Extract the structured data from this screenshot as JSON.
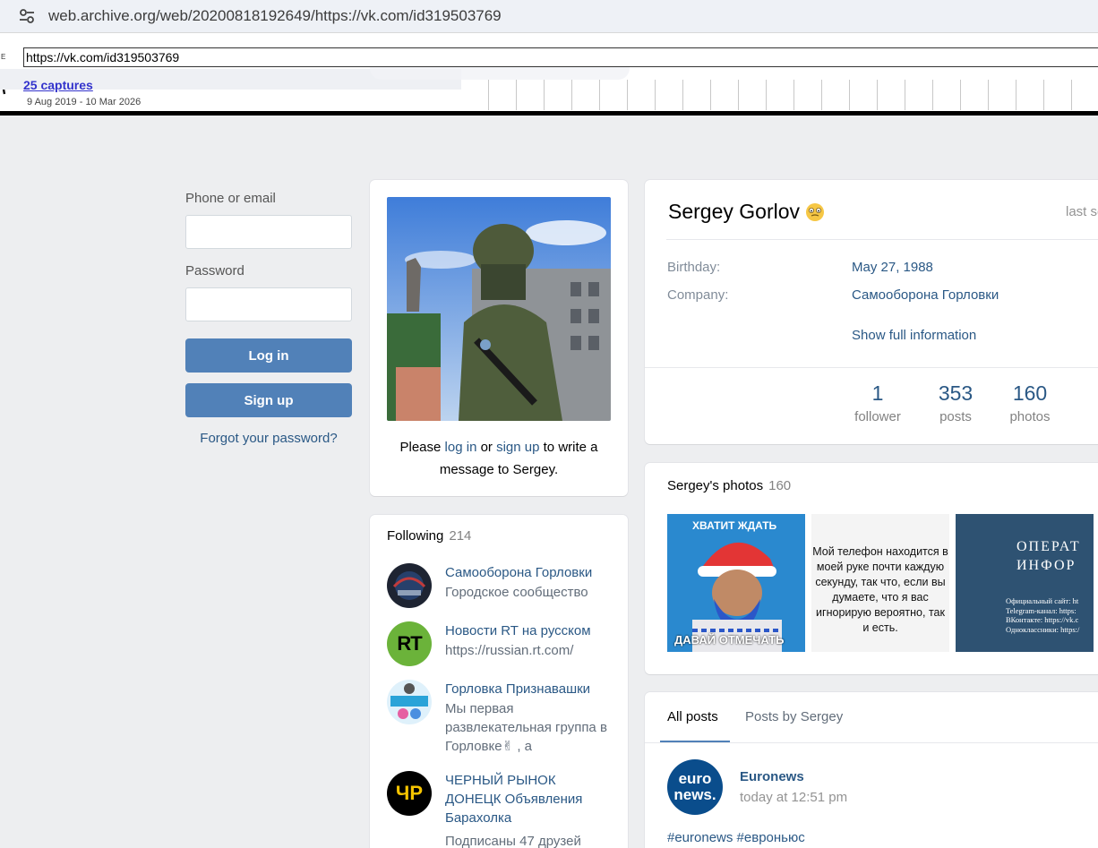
{
  "browser": {
    "url": "web.archive.org/web/20200818192649/https://vk.com/id319503769"
  },
  "wayback": {
    "edge_letter": "E",
    "url_input": "https://vk.com/id319503769",
    "captures_label": "25 captures",
    "date_range": "9 Aug 2019 - 10 Mar 2026"
  },
  "login": {
    "phone_label": "Phone or email",
    "password_label": "Password",
    "login_button": "Log in",
    "signup_button": "Sign up",
    "forgot_link": "Forgot your password?"
  },
  "avatar_card": {
    "msg_prefix": "Please ",
    "login_link": "log in",
    "msg_or": " or ",
    "signup_link": "sign up",
    "msg_suffix": " to write a message to Sergey."
  },
  "following": {
    "title": "Following",
    "count": "214",
    "items": [
      {
        "name": "Самооборона Горловки",
        "sub": "Городское сообщество"
      },
      {
        "name": "Новости RT на русском",
        "sub": "https://russian.rt.com/",
        "badge": "RT"
      },
      {
        "name": "Горловка Признавашки",
        "sub": "Мы первая развлекательная группа в Горловке✌ , а"
      },
      {
        "name": "ЧЕРНЫЙ РЫНОК ДОНЕЦК Объявления Барахолка",
        "sub": "Подписаны 47 друзей",
        "badge": "ЧР"
      }
    ]
  },
  "profile": {
    "name": "Sergey Gorlov",
    "last_seen": "last seen",
    "birthday_label": "Birthday:",
    "birthday_value": "May 27, 1988",
    "company_label": "Company:",
    "company_value": "Самооборона Горловки",
    "show_full": "Show full information",
    "counters": [
      {
        "num": "1",
        "label": "follower"
      },
      {
        "num": "353",
        "label": "posts"
      },
      {
        "num": "160",
        "label": "photos"
      }
    ]
  },
  "photos": {
    "title": "Sergey's photos",
    "count": "160",
    "photo1_top": "ХВАТИТ ЖДАТЬ",
    "photo1_bottom": "ДАВАЙ ОТМЕЧАТЬ",
    "photo2_text": "Мой телефон находится в моей руке почти каждую секунду, так что, если вы думаете, что я вас игнорирую вероятно, так и есть.",
    "photo3_title": "ОПЕРАТ ИНФОР",
    "photo3_lines": "Официальный сайт: ht\nTelegram-канал: https:\nВКонтакте: https://vk.c\nОдноклассники: https:/"
  },
  "posts": {
    "tab_all": "All posts",
    "tab_by": "Posts by Sergey",
    "author": "Euronews",
    "time": "today at 12:51 pm",
    "avatar_text_1": "euro",
    "avatar_text_2": "news.",
    "tags": "#euronews #евроньюс"
  }
}
